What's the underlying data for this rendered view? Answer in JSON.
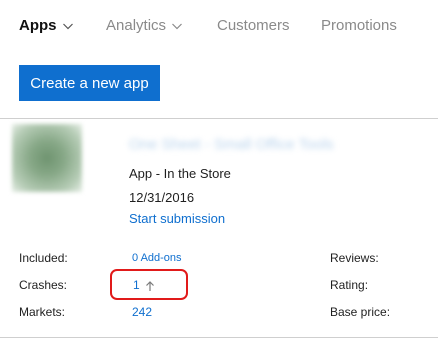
{
  "nav": {
    "items": [
      {
        "label": "Apps",
        "active": true,
        "has_dropdown": true
      },
      {
        "label": "Analytics",
        "active": false,
        "has_dropdown": true
      },
      {
        "label": "Customers",
        "active": false,
        "has_dropdown": false
      },
      {
        "label": "Promotions",
        "active": false,
        "has_dropdown": false
      }
    ]
  },
  "toolbar": {
    "create_label": "Create a new app"
  },
  "app": {
    "name": "One Sheet - Small Office Tools",
    "status": "App - In the Store",
    "date": "12/31/2016",
    "start_submission_label": "Start submission"
  },
  "stats": {
    "included_label": "Included:",
    "included_value": "0 Add-ons",
    "crashes_label": "Crashes:",
    "crashes_value": "1",
    "crashes_trend_icon": "up-arrow-icon",
    "markets_label": "Markets:",
    "markets_value": "242",
    "reviews_label": "Reviews:",
    "rating_label": "Rating:",
    "base_price_label": "Base price:"
  },
  "colors": {
    "accent": "#0f6fcf",
    "highlight": "#e11a1a"
  }
}
